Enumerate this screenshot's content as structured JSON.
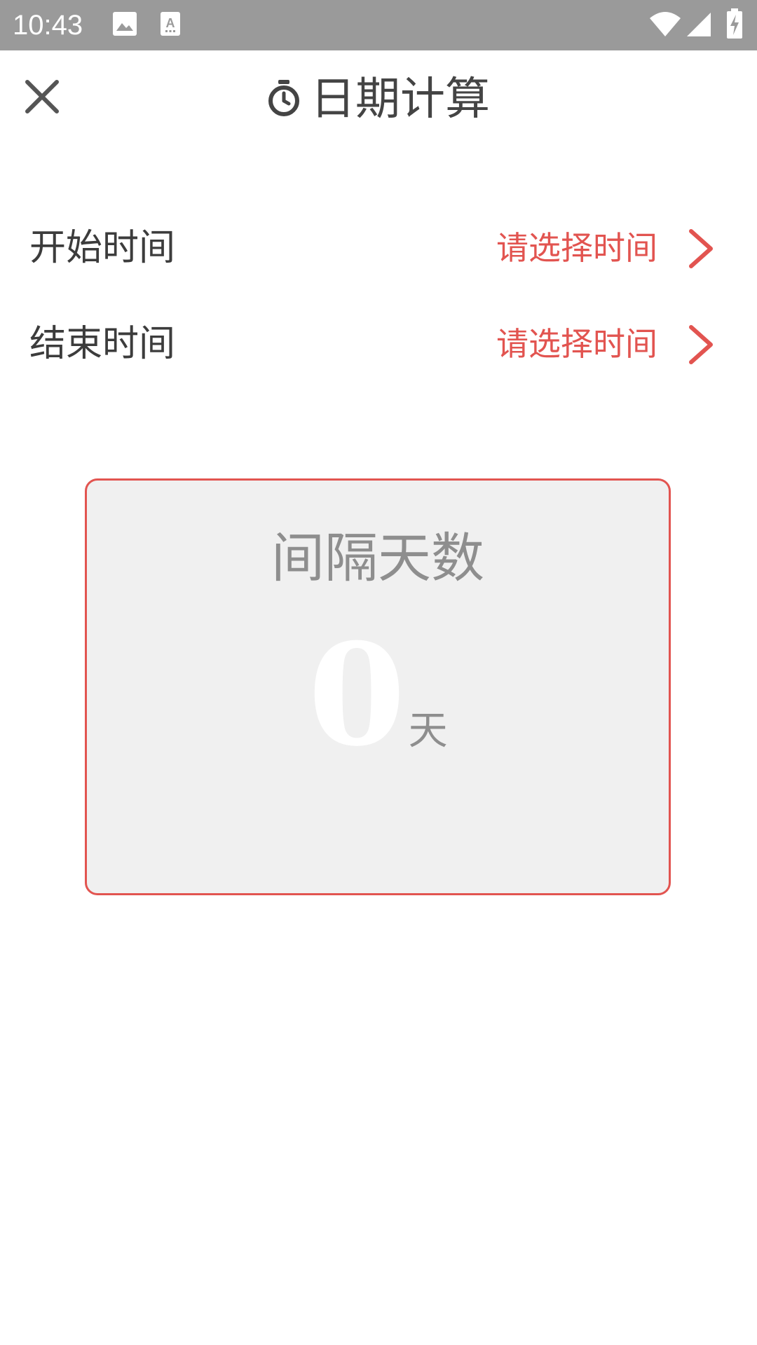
{
  "status_bar": {
    "time": "10:43",
    "icons": [
      "image-icon",
      "font-a-icon",
      "wifi-icon",
      "cell-signal-icon",
      "battery-charging-icon"
    ]
  },
  "toolbar": {
    "close_icon": "close-icon",
    "title_icon": "timer-icon",
    "title": "日期计算"
  },
  "start_row": {
    "label": "开始时间",
    "value": "请选择时间",
    "icon": "chevron-right-icon"
  },
  "end_row": {
    "label": "结束时间",
    "value": "请选择时间",
    "icon": "chevron-right-icon"
  },
  "result": {
    "title": "间隔天数",
    "value": "0",
    "unit": "天"
  },
  "colors": {
    "accent": "#e25450",
    "status_bar": "#9a9a9a",
    "card_bg": "#f0f0f0",
    "text_dark": "#3c3c3c",
    "text_gray": "#8e8e8e"
  }
}
